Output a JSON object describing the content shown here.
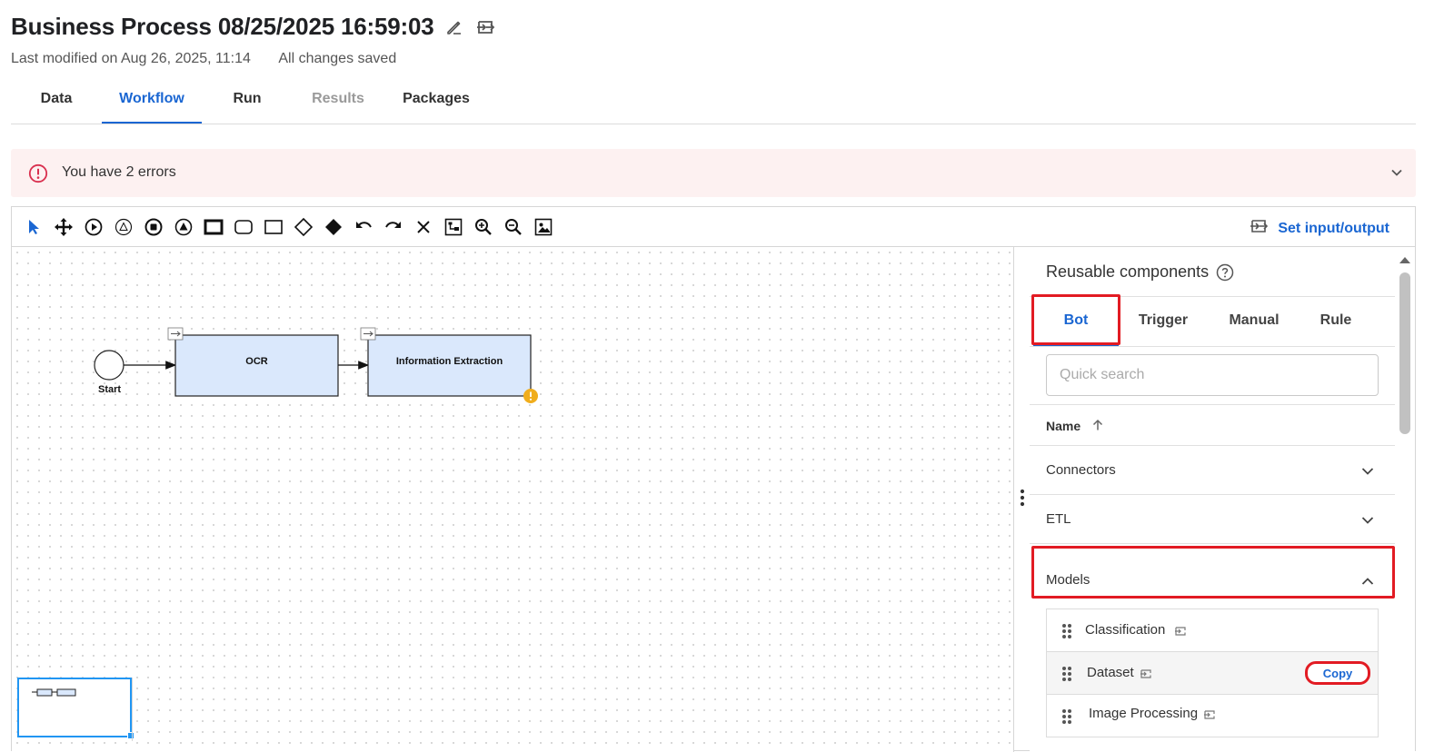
{
  "header": {
    "title": "Business Process 08/25/2025 16:59:03",
    "last_modified": "Last modified on Aug 26, 2025, 11:14",
    "save_status": "All changes saved"
  },
  "tabs": [
    {
      "label": "Data",
      "state": "normal"
    },
    {
      "label": "Workflow",
      "state": "active"
    },
    {
      "label": "Run",
      "state": "normal"
    },
    {
      "label": "Results",
      "state": "disabled"
    },
    {
      "label": "Packages",
      "state": "normal"
    }
  ],
  "errors": {
    "message": "You have 2 errors"
  },
  "toolbar": {
    "tools": [
      "pointer-icon",
      "move-icon",
      "start-event-icon",
      "intermediate-event-icon",
      "end-event-icon",
      "signal-event-icon",
      "bold-task-icon",
      "rounded-task-icon",
      "task-icon",
      "gateway-icon",
      "filled-gateway-icon",
      "undo-icon",
      "redo-icon",
      "delete-icon",
      "auto-layout-icon",
      "zoom-in-icon",
      "zoom-out-icon",
      "fit-view-icon"
    ],
    "set_io_label": "Set input/output"
  },
  "diagram": {
    "start_label": "Start",
    "tasks": [
      {
        "label": "OCR"
      },
      {
        "label": "Information Extraction"
      }
    ]
  },
  "panel": {
    "title": "Reusable components",
    "tabs": [
      {
        "label": "Bot",
        "active": true
      },
      {
        "label": "Trigger",
        "active": false
      },
      {
        "label": "Manual",
        "active": false
      },
      {
        "label": "Rule",
        "active": false
      }
    ],
    "search_placeholder": "Quick search",
    "column_name": "Name",
    "groups": [
      {
        "label": "Connectors",
        "expanded": false
      },
      {
        "label": "ETL",
        "expanded": false
      },
      {
        "label": "Models",
        "expanded": true
      }
    ],
    "models_items": [
      {
        "label": "Classification"
      },
      {
        "label": "Dataset",
        "action": "Copy"
      },
      {
        "label": "Image Processing"
      }
    ]
  },
  "colors": {
    "accent": "#1a66d2",
    "error_bg": "#fdf1f1",
    "error_icon": "#d9304f",
    "highlight_red": "#e21b23",
    "task_fill": "#dae8fc",
    "warning": "#f0ad1c"
  }
}
